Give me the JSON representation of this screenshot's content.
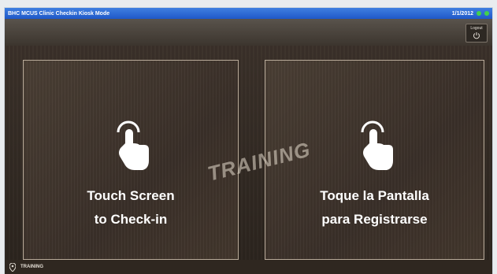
{
  "titlebar": {
    "left_text": "BHC MCUS Clinic Checkin Kiosk Mode",
    "right_text": "1/1/2012",
    "status_colors": [
      "#43d14b",
      "#43d14b"
    ]
  },
  "toolbar": {
    "exit_label": "Logout",
    "exit_icon": "power-icon"
  },
  "panels": {
    "english": {
      "icon": "touch-hand-icon",
      "line1": "Touch Screen",
      "line2": "to Check-in"
    },
    "spanish": {
      "icon": "touch-hand-icon",
      "line1": "Toque la Pantalla",
      "line2": "para Registrarse"
    }
  },
  "watermark": "TRAINING",
  "footer": {
    "icon": "location-pin-icon",
    "label": "TRAINING"
  },
  "colors": {
    "titlebar": "#2f6fd8",
    "background": "#2f2720",
    "panel_border": "#b8aa99",
    "text": "#ffffff"
  }
}
